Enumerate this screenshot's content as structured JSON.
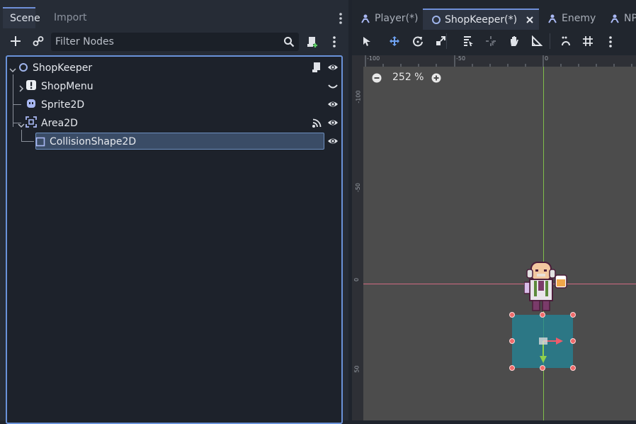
{
  "scene_dock": {
    "tabs": [
      {
        "label": "Scene",
        "active": true
      },
      {
        "label": "Import",
        "active": false
      }
    ],
    "filter_placeholder": "Filter Nodes",
    "toolbar_icons": [
      "add-icon",
      "link-icon",
      "search-icon",
      "attach-script-icon",
      "more-icon"
    ]
  },
  "tree": {
    "nodes": [
      {
        "label": "ShopKeeper",
        "icon": "node2d-circle-icon",
        "extra_icon": "script-icon",
        "visible": true,
        "expanded": true
      },
      {
        "label": "ShopMenu",
        "icon": "warning-icon",
        "extra_icon": "hidden-icon",
        "expanded": false
      },
      {
        "label": "Sprite2D",
        "icon": "sprite2d-icon",
        "visible": true
      },
      {
        "label": "Area2D",
        "icon": "area2d-icon",
        "extra_icon": "signal-icon",
        "visible": true,
        "expanded": true
      },
      {
        "label": "CollisionShape2D",
        "icon": "collisionshape-square-icon",
        "visible": true,
        "selected": true
      }
    ]
  },
  "editor": {
    "tabs": [
      {
        "label": "Player(*)",
        "icon": "scene-node-icon"
      },
      {
        "label": "ShopKeeper(*)",
        "icon": "node2d-circle-icon",
        "active": true,
        "closable": true
      },
      {
        "label": "Enemy",
        "icon": "scene-node-icon"
      },
      {
        "label": "NP",
        "icon": "scene-node-icon"
      }
    ],
    "toolbar_icons": [
      "select-arrow-icon",
      "move-icon",
      "rotate-icon",
      "scale-icon",
      "list-select-icon",
      "pivot-icon",
      "pan-hand-icon",
      "ruler-icon",
      "snap-dots-icon",
      "grid-snap-icon",
      "more-icon"
    ],
    "zoom": "252 %",
    "ruler_top": [
      "-100",
      "-50",
      "0"
    ],
    "ruler_left": [
      "-100",
      "-50",
      "0",
      "50"
    ],
    "colors": {
      "y_axis": "#7fbf4a",
      "x_axis": "#d06a82",
      "shape_fill": "#2f7f8f",
      "handle": "#ef6b6b"
    }
  }
}
